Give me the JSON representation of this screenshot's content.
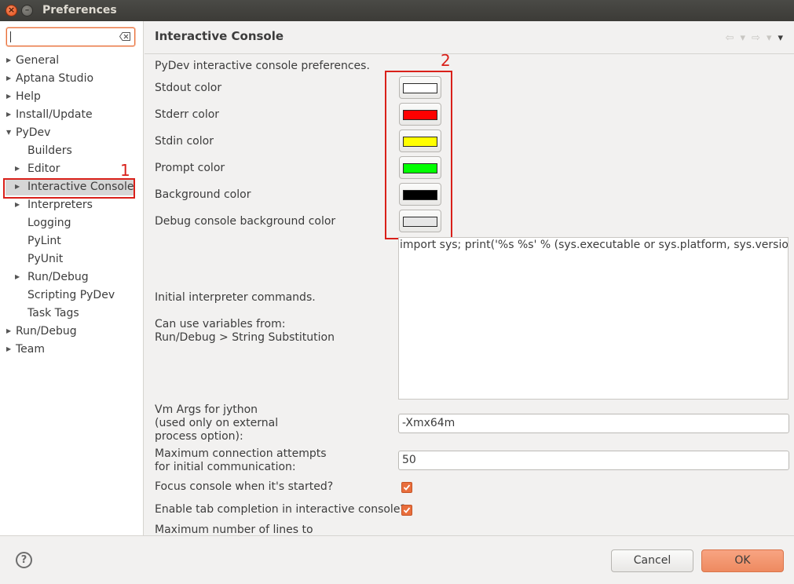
{
  "window": {
    "title": "Preferences"
  },
  "search": {
    "value": ""
  },
  "tree": {
    "general": "General",
    "aptana": "Aptana Studio",
    "help": "Help",
    "install": "Install/Update",
    "pydev": "PyDev",
    "builders": "Builders",
    "editor": "Editor",
    "interactive_console": "Interactive Console",
    "interpreters": "Interpreters",
    "logging": "Logging",
    "pylint": "PyLint",
    "pyunit": "PyUnit",
    "pydev_rundebug": "Run/Debug",
    "scripting": "Scripting PyDev",
    "task_tags": "Task Tags",
    "rundebug": "Run/Debug",
    "team": "Team"
  },
  "annotations": {
    "first": "1",
    "second": "2",
    "color": "#d9201a"
  },
  "page": {
    "title": "Interactive Console",
    "description": "PyDev interactive console preferences.",
    "colors": [
      {
        "label": "Stdout color",
        "value": "#ffffff"
      },
      {
        "label": "Stderr color",
        "value": "#ff0000"
      },
      {
        "label": "Stdin color",
        "value": "#ffff00"
      },
      {
        "label": "Prompt color",
        "value": "#00ff00"
      },
      {
        "label": "Background color",
        "value": "#000000"
      },
      {
        "label": "Debug console background color",
        "value": "#e6e6e6"
      }
    ],
    "initial_commands_label": "Initial interpreter commands.",
    "variables_label_1": "Can use variables from:",
    "variables_label_2": "Run/Debug > String Substitution",
    "initial_commands_value": "import sys; print('%s %s' % (sys.executable or sys.platform, sys.version))",
    "vm_args_label_1": "Vm Args for jython",
    "vm_args_label_2": "(used only on external",
    "vm_args_label_3": "process option):",
    "vm_args_value": "-Xmx64m",
    "max_conn_label_1": "Maximum connection attempts",
    "max_conn_label_2": "for initial communication:",
    "max_conn_value": "50",
    "focus_console_label": "Focus console when it's started?",
    "focus_console_checked": true,
    "tab_completion_label": "Enable tab completion in interactive console?",
    "tab_completion_checked": true,
    "max_lines_label": "Maximum number of lines to"
  },
  "footer": {
    "help": "?",
    "cancel": "Cancel",
    "ok": "OK"
  }
}
